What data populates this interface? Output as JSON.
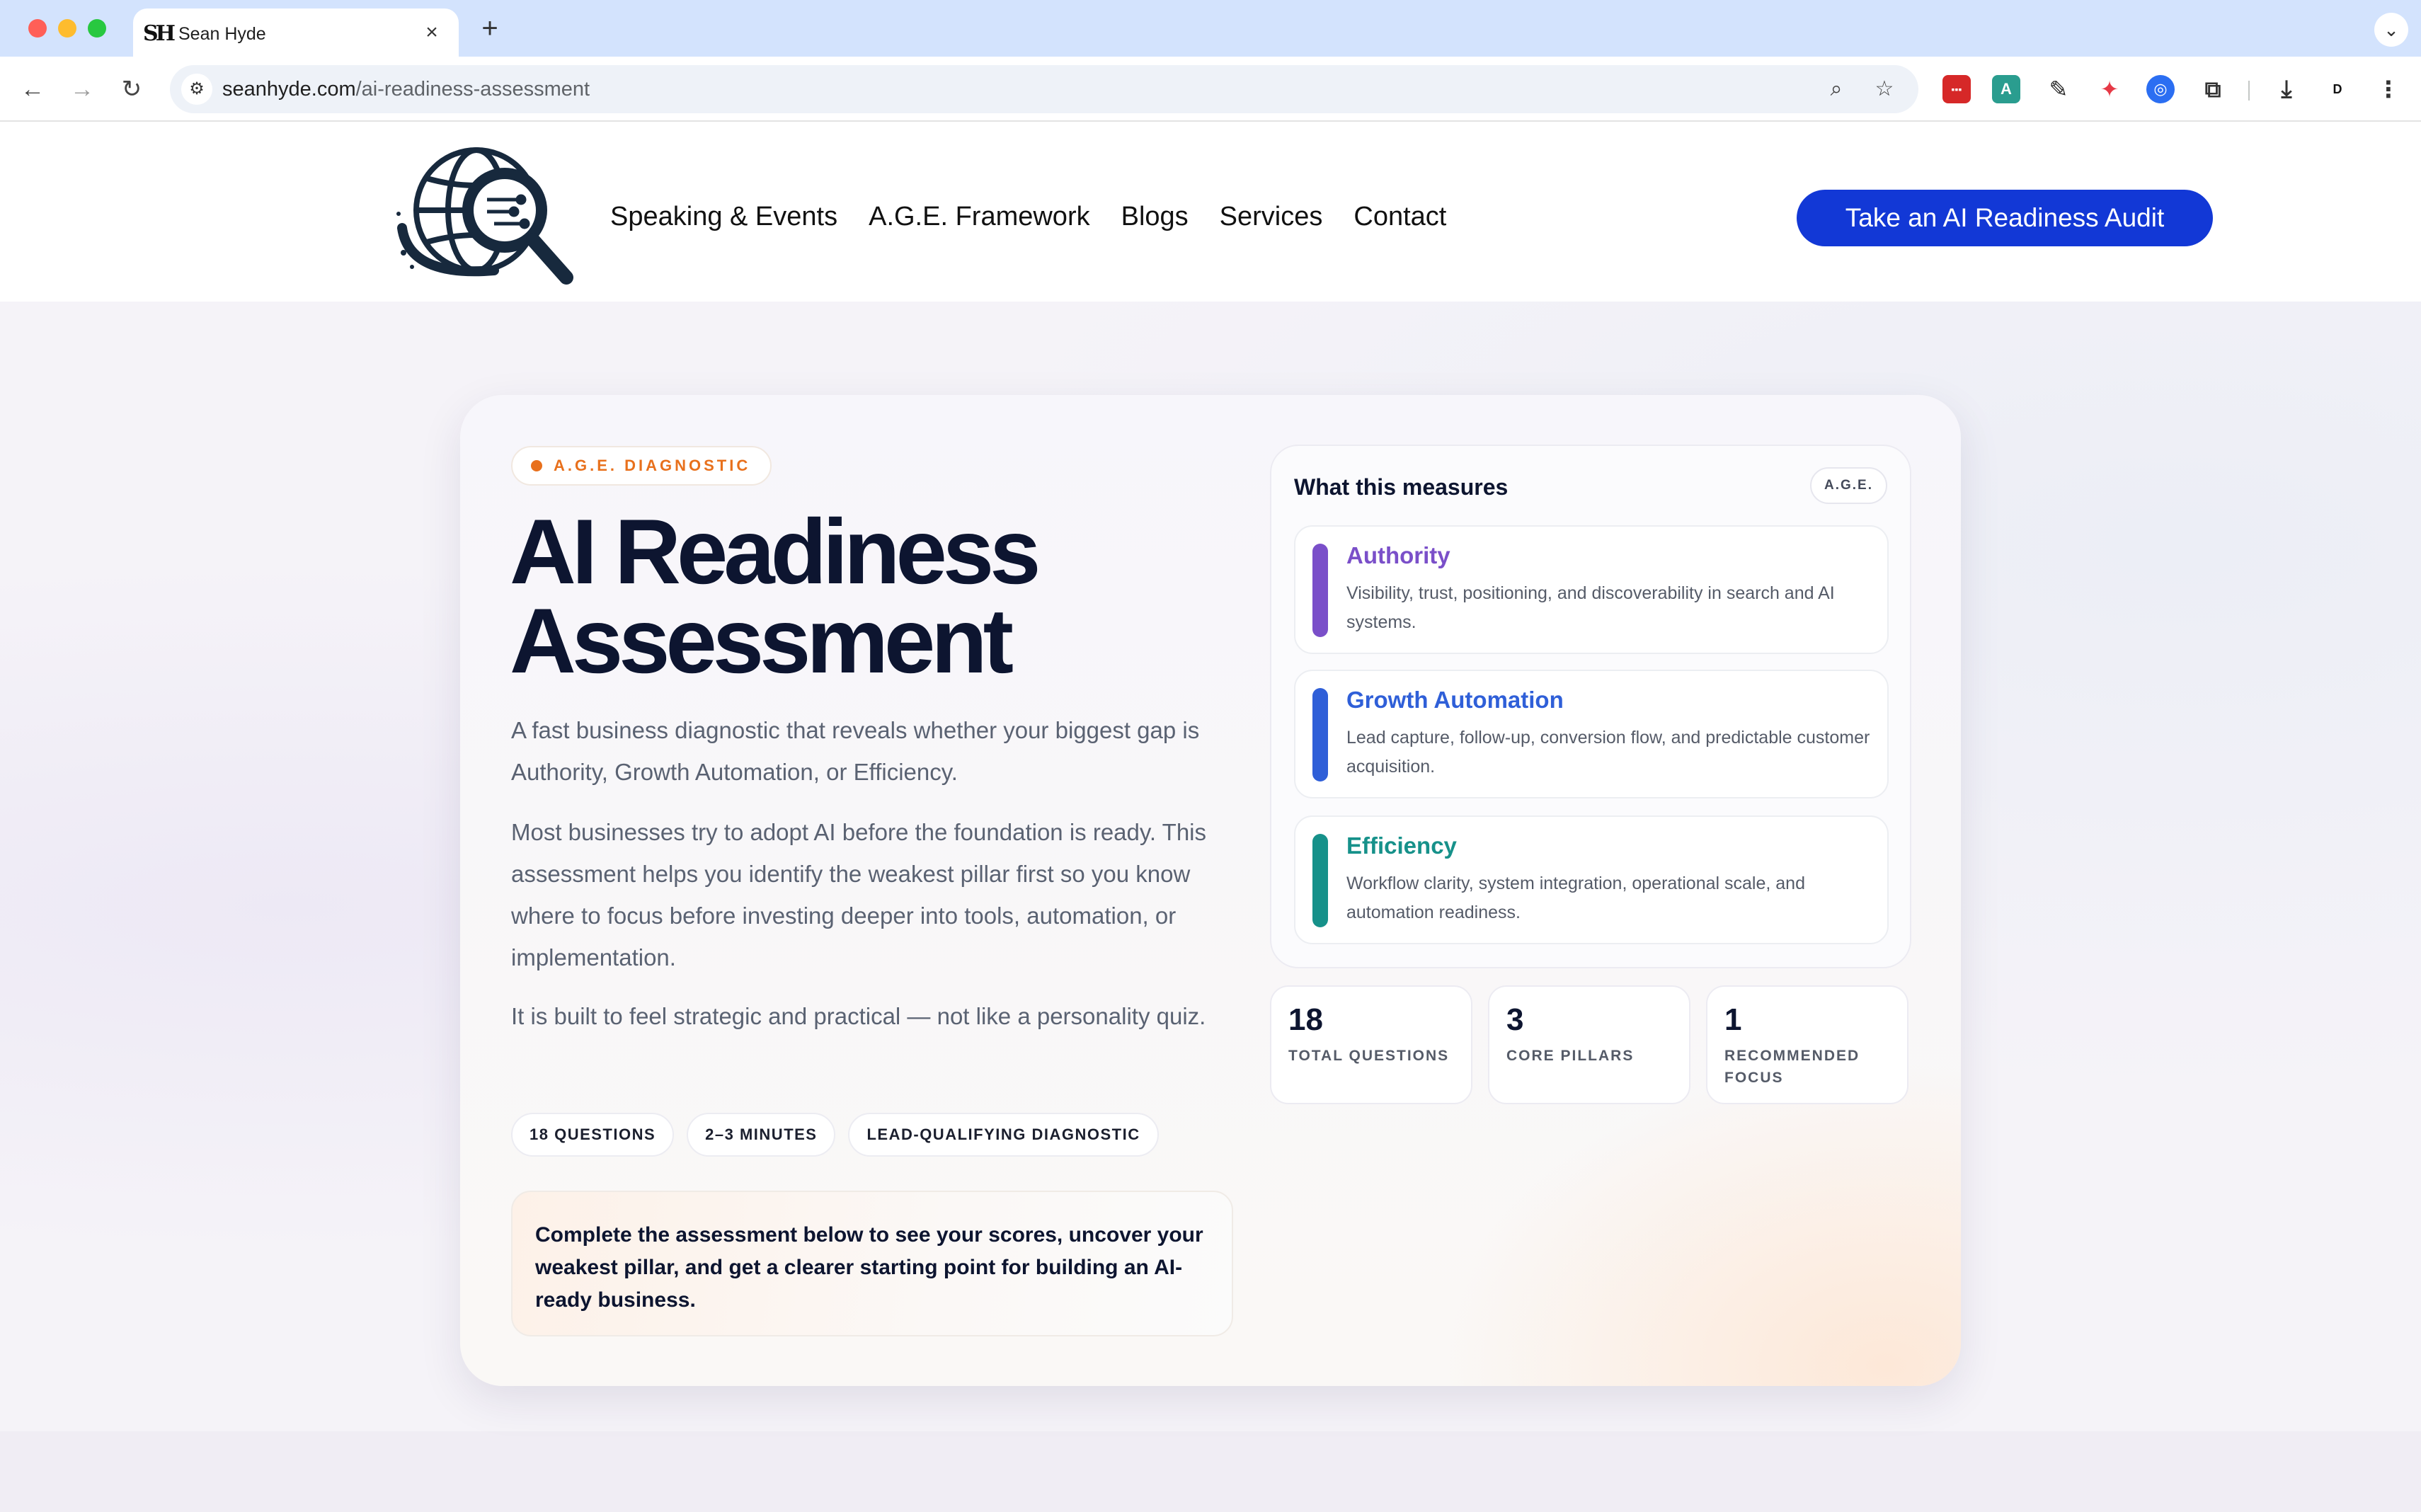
{
  "browser": {
    "tab_title": "Sean Hyde",
    "favicon_text": "SH",
    "url_host": "seanhyde.com",
    "url_path": "/ai-readiness-assessment"
  },
  "header": {
    "nav": [
      "Speaking & Events",
      "A.G.E. Framework",
      "Blogs",
      "Services",
      "Contact"
    ],
    "cta_label": "Take an AI Readiness Audit"
  },
  "hero": {
    "badge": "A.G.E. DIAGNOSTIC",
    "title_line1": "AI Readiness",
    "title_line2": "Assessment",
    "lead": "A fast business diagnostic that reveals whether your biggest gap is Authority, Growth Automation, or Efficiency.",
    "para2": "Most businesses try to adopt AI before the foundation is ready. This assessment helps you identify the weakest pillar first so you know where to focus before investing deeper into tools, automation, or implementation.",
    "para3": "It is built to feel strategic and practical — not like a personality quiz.",
    "chips": [
      "18 QUESTIONS",
      "2–3 MINUTES",
      "LEAD-QUALIFYING DIAGNOSTIC"
    ],
    "callout": "Complete the assessment below to see your scores, uncover your weakest pillar, and get a clearer starting point for building an AI-ready business."
  },
  "panel": {
    "title": "What this measures",
    "tag": "A.G.E.",
    "pillars": [
      {
        "name": "Authority",
        "desc": "Visibility, trust, positioning, and discoverability in search and AI systems.",
        "color": "#7a4fc9"
      },
      {
        "name": "Growth Automation",
        "desc": "Lead capture, follow-up, conversion flow, and predictable customer acquisition.",
        "color": "#2f5fd8"
      },
      {
        "name": "Efficiency",
        "desc": "Workflow clarity, system integration, operational scale, and automation readiness.",
        "color": "#16918a"
      }
    ]
  },
  "stats": [
    {
      "num": "18",
      "label": "TOTAL QUESTIONS"
    },
    {
      "num": "3",
      "label": "CORE PILLARS"
    },
    {
      "num": "1",
      "label": "RECOMMENDED FOCUS"
    }
  ],
  "colors": {
    "cta_blue": "#1238d6",
    "badge_orange": "#e8701c",
    "heading_navy": "#0d1530"
  }
}
